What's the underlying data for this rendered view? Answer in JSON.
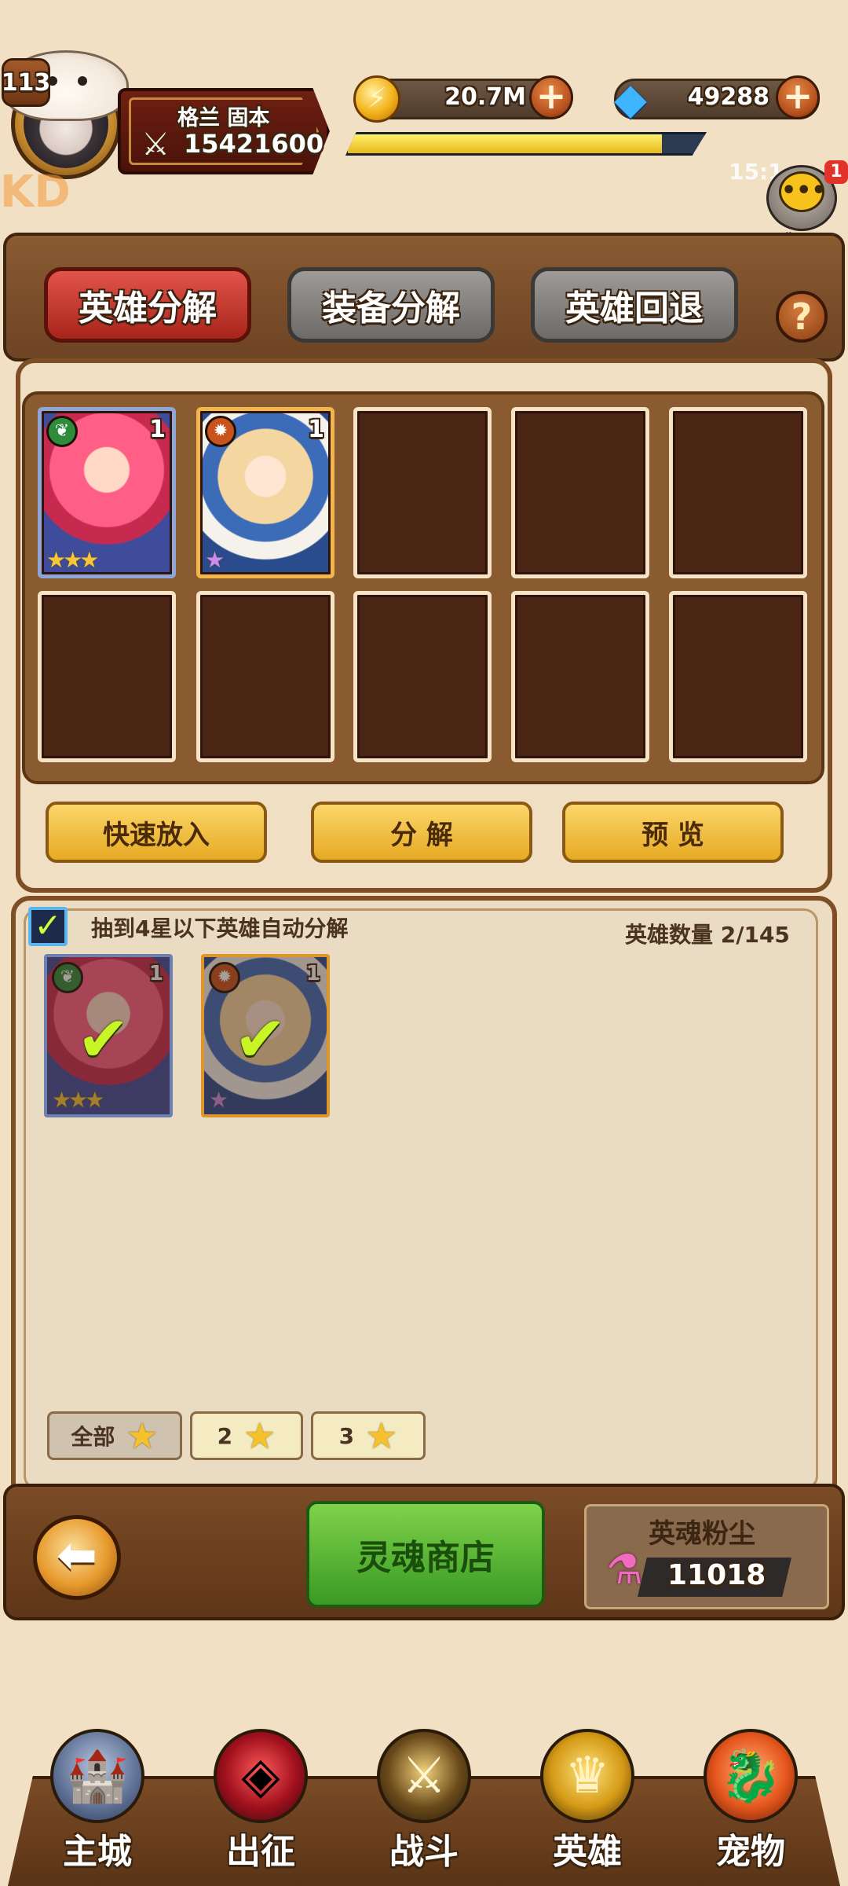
{
  "player": {
    "level": "113",
    "name": "格兰 固本",
    "power": "15421600"
  },
  "resources": {
    "gold": "20.7M",
    "gems": "49288",
    "xp_fraction": 0.88
  },
  "clock": "15:1",
  "watermark": "KD",
  "chat": {
    "label": "聊天",
    "badge": "1"
  },
  "tabs": [
    {
      "label": "英雄分解",
      "active": true
    },
    {
      "label": "装备分解",
      "active": false
    },
    {
      "label": "英雄回退",
      "active": false
    }
  ],
  "help_icon": "question-icon",
  "decompose_slots": [
    {
      "level": "1",
      "element": "nature",
      "stars": "★★★",
      "art": "pink-hair-hero"
    },
    {
      "level": "1",
      "element": "fire",
      "stars": "★",
      "art": "blonde-hat-hero"
    }
  ],
  "actions": {
    "quick_add": "快速放入",
    "decompose": "分 解",
    "preview": "预 览"
  },
  "list": {
    "auto_label": "抽到4星以下英雄自动分解",
    "auto_checked": true,
    "count_label": "英雄数量 2/145"
  },
  "filters": [
    {
      "label": "全部",
      "star": "★"
    },
    {
      "label": "2",
      "star": "★"
    },
    {
      "label": "3",
      "star": "★"
    }
  ],
  "soul_shop": "灵魂商店",
  "dust": {
    "title": "英魂粉尘",
    "value": "11018"
  },
  "nav": [
    {
      "label": "主城",
      "icon": "castle-tower-icon"
    },
    {
      "label": "出征",
      "icon": "red-crystal-icon"
    },
    {
      "label": "战斗",
      "icon": "crossed-swords-shield-icon"
    },
    {
      "label": "英雄",
      "icon": "golden-helmet-icon"
    },
    {
      "label": "宠物",
      "icon": "dragon-pet-icon"
    }
  ],
  "colors": {
    "tab_active": "#c83a2e",
    "tab_inactive": "#8a8785",
    "gold_button": "#f0c040",
    "green_button": "#56b832",
    "check": "#c8f526"
  }
}
